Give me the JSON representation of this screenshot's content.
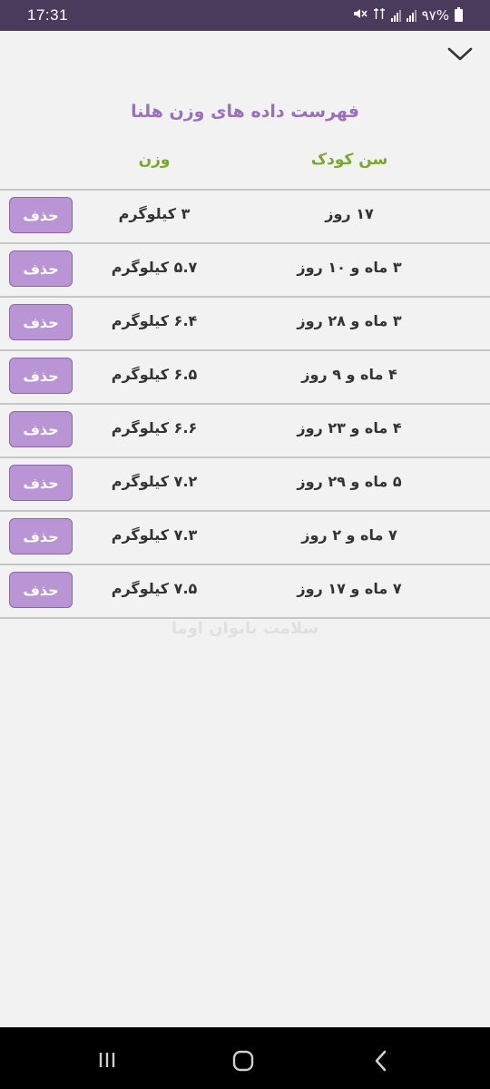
{
  "status_bar": {
    "time": "17:31",
    "battery_text": "۹۷%",
    "icons": [
      "mute-icon",
      "data-icon",
      "signal-icon",
      "signal-icon",
      "battery-icon"
    ]
  },
  "header": {
    "title": "فهرست داده های وزن هلنا",
    "collapse_icon": "chevron-down-icon"
  },
  "table": {
    "headers": {
      "age": "سن کودک",
      "weight": "وزن"
    },
    "rows": [
      {
        "age": "۱۷ روز",
        "weight": "۳ کیلوگرم",
        "action": "حذف"
      },
      {
        "age": "۳ ماه و ۱۰ روز",
        "weight": "۵.۷ کیلوگرم",
        "action": "حذف"
      },
      {
        "age": "۳ ماه و ۲۸ روز",
        "weight": "۶.۴ کیلوگرم",
        "action": "حذف"
      },
      {
        "age": "۴ ماه و ۹ روز",
        "weight": "۶.۵ کیلوگرم",
        "action": "حذف"
      },
      {
        "age": "۴ ماه و ۲۳ روز",
        "weight": "۶.۶ کیلوگرم",
        "action": "حذف"
      },
      {
        "age": "۵ ماه و ۲۹ روز",
        "weight": "۷.۲ کیلوگرم",
        "action": "حذف"
      },
      {
        "age": "۷ ماه و ۲ روز",
        "weight": "۷.۳ کیلوگرم",
        "action": "حذف"
      },
      {
        "age": "۷ ماه و ۱۷ روز",
        "weight": "۷.۵ کیلوگرم",
        "action": "حذف"
      }
    ]
  },
  "watermark": "سلامت بانوان اوما",
  "colors": {
    "status_bar": "#4a3a5c",
    "title": "#9b6fbf",
    "column_header": "#7aa82a",
    "delete_button": "#b995d6"
  },
  "nav_bar": {
    "icons": [
      "recents-icon",
      "home-icon",
      "back-icon"
    ]
  }
}
